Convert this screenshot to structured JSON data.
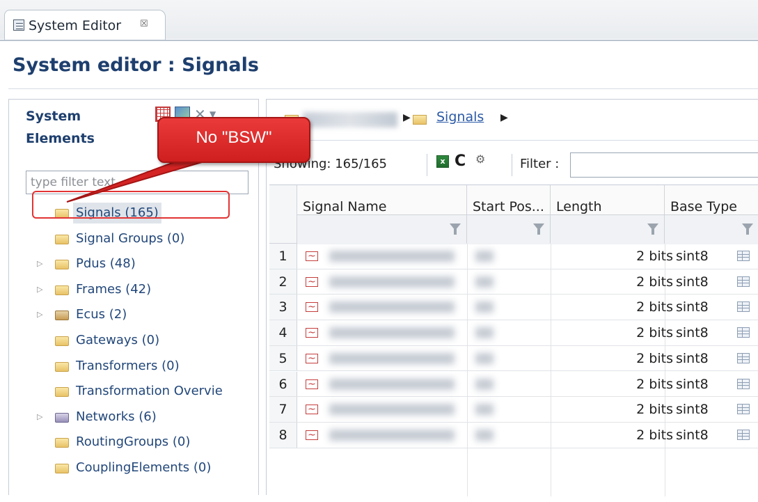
{
  "tab": {
    "title": "System Editor",
    "close_glyph": "☒"
  },
  "editor": {
    "title": "System editor : Signals"
  },
  "left_panel": {
    "title": "System Elements",
    "filter_placeholder": "type filter text",
    "tree": [
      {
        "label": "Signals (165)",
        "icon": "folder-icon",
        "expandable": false,
        "selected": true
      },
      {
        "label": "Signal Groups (0)",
        "icon": "folder-icon",
        "expandable": false
      },
      {
        "label": "Pdus (48)",
        "icon": "folder-icon",
        "expandable": true
      },
      {
        "label": "Frames (42)",
        "icon": "folder-icon",
        "expandable": true
      },
      {
        "label": "Ecus (2)",
        "icon": "ecu-folder-icon",
        "expandable": true
      },
      {
        "label": "Gateways (0)",
        "icon": "folder-icon",
        "expandable": false
      },
      {
        "label": "Transformers (0)",
        "icon": "folder-icon",
        "expandable": false
      },
      {
        "label": "Transformation Overvie",
        "icon": "folder-icon",
        "expandable": false
      },
      {
        "label": "Networks (6)",
        "icon": "network-folder-icon",
        "expandable": true
      },
      {
        "label": "RoutingGroups (0)",
        "icon": "folder-icon",
        "expandable": false
      },
      {
        "label": "CouplingElements (0)",
        "icon": "folder-icon",
        "expandable": false
      }
    ]
  },
  "breadcrumb": {
    "current": "Signals"
  },
  "toolbar": {
    "showing": "Showing: 165/165",
    "filter_label": "Filter :",
    "filter_value": ""
  },
  "table": {
    "columns": [
      "Signal Name",
      "Start Pos...",
      "Length",
      "Base Type"
    ],
    "rows": [
      {
        "index": "1",
        "length": "2 bits",
        "base_type": "sint8"
      },
      {
        "index": "2",
        "length": "2 bits",
        "base_type": "sint8"
      },
      {
        "index": "3",
        "length": "2 bits",
        "base_type": "sint8"
      },
      {
        "index": "4",
        "length": "2 bits",
        "base_type": "sint8"
      },
      {
        "index": "5",
        "length": "2 bits",
        "base_type": "sint8"
      },
      {
        "index": "6",
        "length": "2 bits",
        "base_type": "sint8"
      },
      {
        "index": "7",
        "length": "2 bits",
        "base_type": "sint8"
      },
      {
        "index": "8",
        "length": "2 bits",
        "base_type": "sint8"
      }
    ]
  },
  "callout": {
    "text": "No \"BSW\"",
    "color": "#dd2a2a"
  }
}
